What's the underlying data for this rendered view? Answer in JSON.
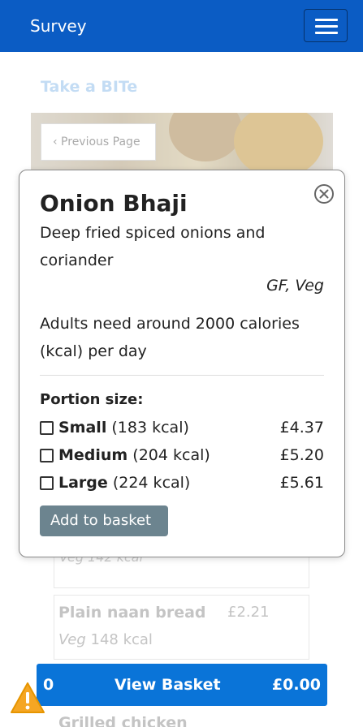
{
  "navbar": {
    "title": "Survey",
    "menu_icon": "hamburger-menu-icon",
    "color": "#0b5cc4"
  },
  "background": {
    "heading": "Take a BITe",
    "previous_page_label": "‹ Previous Page",
    "card_ghost_text": "Veg 142 kcal",
    "items": [
      {
        "name": "Plain naan bread",
        "price": "£2.21",
        "tag": "Veg",
        "kcal": "148 kcal"
      }
    ],
    "next_item_partial": "Grilled chicken"
  },
  "modal": {
    "title": "Onion Bhaji",
    "description": "Deep fried spiced onions and coriander",
    "tags": "GF, Veg",
    "calorie_note": "Adults need around 2000 calories (kcal) per day",
    "portion_heading": "Portion size:",
    "options": [
      {
        "name": "Small",
        "kcal": "(183 kcal)",
        "price": "£4.37",
        "checked": false
      },
      {
        "name": "Medium",
        "kcal": "(204 kcal)",
        "price": "£5.20",
        "checked": false
      },
      {
        "name": "Large",
        "kcal": "(224 kcal)",
        "price": "£5.61",
        "checked": false
      }
    ],
    "add_button_label": "Add to basket",
    "close_icon": "close-circle-icon"
  },
  "basket": {
    "count": "0",
    "label": "View Basket",
    "total": "£0.00",
    "color": "#0a74d8"
  },
  "warning_icon": "warning-triangle-icon"
}
